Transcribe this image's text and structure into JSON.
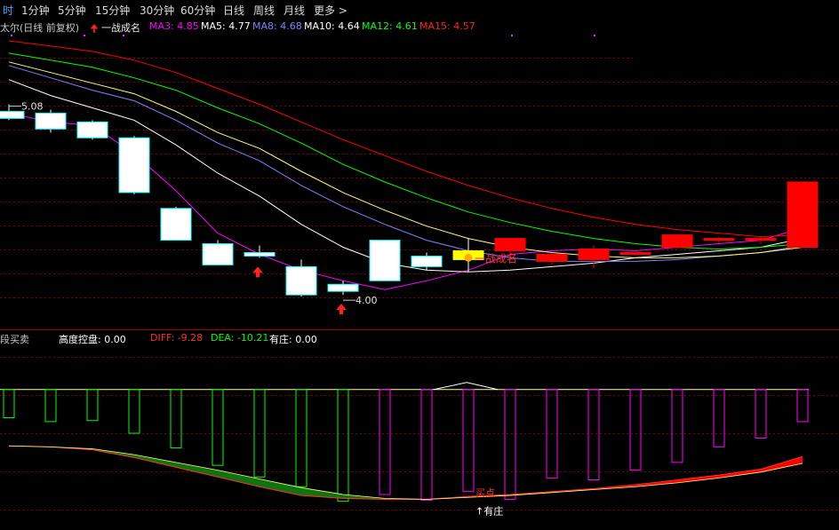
{
  "toolbar": {
    "tabs": [
      {
        "label": "时",
        "active": true
      },
      {
        "label": "1分钟"
      },
      {
        "label": "5分钟"
      },
      {
        "label": "15分钟"
      },
      {
        "label": "30分钟"
      },
      {
        "label": "60分钟"
      },
      {
        "label": "日线"
      },
      {
        "label": "周线"
      },
      {
        "label": "月线"
      },
      {
        "label": "更多 >"
      }
    ]
  },
  "main_legend": {
    "stock": "太尔(日线 前复权)",
    "signal": "一战成名",
    "ma3": "MA3: 4.85",
    "ma5": "MA5: 4.77",
    "ma8": "MA8: 4.68",
    "ma10": "MA10: 4.64",
    "ma12": "MA12: 4.61",
    "ma15": "MA15: 4.57"
  },
  "sub_legend": {
    "name": "段买卖",
    "gdkp": "高度控盘: 0.00",
    "diff": "DIFF: -9.28",
    "dea": "DEA: -10.21",
    "yz": "有庄: 0.00"
  },
  "colors": {
    "up": "#ff0000",
    "down_fill": "#ffffff",
    "down_edge": "#00ffff",
    "signal": "#ffff00",
    "ma3": "#ff00ff",
    "ma5": "#ffffff",
    "ma8": "#8080ff",
    "ma10": "#ffff80",
    "ma12": "#00ff00",
    "ma15": "#ff0000"
  },
  "chart_data": [
    {
      "type": "candlestick",
      "title": "太尔(日线 前复权)",
      "ylim": [
        3.85,
        5.45
      ],
      "candles": [
        {
          "o": 5.02,
          "h": 5.06,
          "l": 4.97,
          "c": 4.98
        },
        {
          "o": 5.01,
          "h": 5.03,
          "l": 4.9,
          "c": 4.92
        },
        {
          "o": 4.96,
          "h": 4.97,
          "l": 4.86,
          "c": 4.87
        },
        {
          "o": 4.87,
          "h": 4.88,
          "l": 4.55,
          "c": 4.56
        },
        {
          "o": 4.47,
          "h": 4.48,
          "l": 4.29,
          "c": 4.29
        },
        {
          "o": 4.27,
          "h": 4.29,
          "l": 4.15,
          "c": 4.15
        },
        {
          "o": 4.22,
          "h": 4.26,
          "l": 4.19,
          "c": 4.2
        },
        {
          "o": 4.14,
          "h": 4.18,
          "l": 3.97,
          "c": 3.98
        },
        {
          "o": 4.04,
          "h": 4.06,
          "l": 3.98,
          "c": 4.0
        },
        {
          "o": 4.29,
          "h": 4.29,
          "l": 4.06,
          "c": 4.06
        },
        {
          "o": 4.2,
          "h": 4.22,
          "l": 4.12,
          "c": 4.14
        },
        {
          "o": 4.23,
          "h": 4.3,
          "l": 4.11,
          "c": 4.18,
          "signal": true
        },
        {
          "o": 4.23,
          "h": 4.28,
          "l": 4.18,
          "c": 4.3
        },
        {
          "o": 4.17,
          "h": 4.21,
          "l": 4.15,
          "c": 4.21
        },
        {
          "o": 4.18,
          "h": 4.26,
          "l": 4.13,
          "c": 4.24
        },
        {
          "o": 4.21,
          "h": 4.22,
          "l": 4.2,
          "c": 4.22
        },
        {
          "o": 4.25,
          "h": 4.32,
          "l": 4.24,
          "c": 4.32
        },
        {
          "o": 4.29,
          "h": 4.31,
          "l": 4.27,
          "c": 4.3
        },
        {
          "o": 4.29,
          "h": 4.31,
          "l": 4.27,
          "c": 4.3
        },
        {
          "o": 4.25,
          "h": 4.62,
          "l": 4.25,
          "c": 4.62
        }
      ],
      "ma_series": [
        {
          "name": "MA3",
          "color": "#ff00ff",
          "values": [
            5.01,
            4.96,
            4.94,
            4.78,
            4.57,
            4.33,
            4.21,
            4.12,
            4.06,
            4.01,
            4.06,
            4.12,
            4.21,
            4.23,
            4.24,
            4.23,
            4.25,
            4.27,
            4.29,
            4.36
          ]
        },
        {
          "name": "MA5",
          "color": "#ffffff",
          "values": [
            5.2,
            5.11,
            5.04,
            4.97,
            4.83,
            4.67,
            4.54,
            4.38,
            4.25,
            4.16,
            4.12,
            4.11,
            4.12,
            4.14,
            4.16,
            4.19,
            4.21,
            4.23,
            4.25,
            4.3
          ]
        },
        {
          "name": "MA8",
          "color": "#8080ff",
          "values": [
            5.28,
            5.21,
            5.14,
            5.08,
            4.97,
            4.84,
            4.74,
            4.6,
            4.48,
            4.38,
            4.29,
            4.23,
            4.19,
            4.17,
            4.17,
            4.17,
            4.18,
            4.2,
            4.22,
            4.26
          ]
        },
        {
          "name": "MA10",
          "color": "#ffff80",
          "values": [
            5.3,
            5.24,
            5.18,
            5.12,
            5.02,
            4.9,
            4.81,
            4.68,
            4.56,
            4.46,
            4.37,
            4.3,
            4.25,
            4.22,
            4.2,
            4.19,
            4.19,
            4.2,
            4.22,
            4.25
          ]
        },
        {
          "name": "MA12",
          "color": "#00ff00",
          "values": [
            5.35,
            5.31,
            5.27,
            5.21,
            5.14,
            5.04,
            4.95,
            4.84,
            4.72,
            4.62,
            4.53,
            4.45,
            4.39,
            4.34,
            4.3,
            4.27,
            4.25,
            4.24,
            4.25,
            4.27
          ]
        },
        {
          "name": "MA15",
          "color": "#ff0000",
          "values": [
            5.42,
            5.39,
            5.36,
            5.31,
            5.24,
            5.15,
            5.06,
            4.96,
            4.86,
            4.77,
            4.68,
            4.6,
            4.53,
            4.47,
            4.42,
            4.38,
            4.35,
            4.33,
            4.31,
            4.32
          ]
        }
      ],
      "annotations": [
        {
          "text": "5.08",
          "index": 0,
          "value": 5.08
        },
        {
          "text": "4.00",
          "index": 8,
          "value": 3.98
        },
        {
          "text": "一战成名",
          "index": 11,
          "value": 4.15
        }
      ],
      "arrows": [
        {
          "index": 6
        },
        {
          "index": 8
        }
      ]
    },
    {
      "type": "bar+area",
      "title": "段买卖",
      "ylim": [
        -14,
        4
      ],
      "bars": [
        -2.9,
        -3.3,
        -3.2,
        -4.5,
        -6.0,
        -7.8,
        -9.0,
        -10.0,
        -11.5,
        -10.8,
        -11.4,
        -10.5,
        -11.3,
        -9.1,
        -9.3,
        -8.3,
        -7.5,
        -5.9,
        -5.0,
        -3.3
      ],
      "diff": [
        -5.8,
        -5.9,
        -6.2,
        -7.0,
        -8.0,
        -9.0,
        -10.0,
        -10.9,
        -11.2,
        -11.3,
        -11.3,
        -11.0,
        -10.8,
        -10.5,
        -10.2,
        -9.8,
        -9.3,
        -8.8,
        -8.2,
        -6.9
      ],
      "dea": [
        -5.8,
        -5.9,
        -6.1,
        -6.7,
        -7.5,
        -8.3,
        -9.2,
        -10.1,
        -10.8,
        -11.2,
        -11.3,
        -11.1,
        -10.9,
        -10.6,
        -10.3,
        -10.0,
        -9.6,
        -9.1,
        -8.5,
        -7.6
      ],
      "labels": [
        {
          "text": "有庄",
          "index": 11,
          "value": -12.5
        },
        {
          "text": "买点",
          "index": 11,
          "value": -10.6
        }
      ]
    }
  ]
}
